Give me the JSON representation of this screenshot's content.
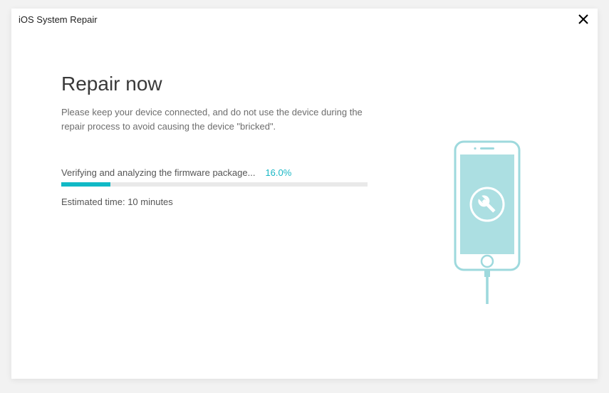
{
  "window": {
    "title": "iOS System Repair"
  },
  "main": {
    "heading": "Repair now",
    "description": "Please keep your device connected, and do not use the device during the repair process to avoid causing the device \"bricked\".",
    "status_label": "Verifying and analyzing the firmware package...",
    "progress_percent_text": "16.0%",
    "progress_percent": 16.0,
    "estimated_time": "Estimated time: 10 minutes"
  },
  "colors": {
    "accent": "#11b9c6",
    "illustration": "#9ed9dd"
  },
  "icons": {
    "close": "close-icon",
    "phone": "phone-repair-illustration",
    "wrench": "wrench-icon"
  }
}
